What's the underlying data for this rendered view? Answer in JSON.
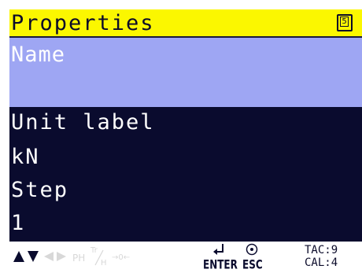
{
  "window": {
    "title": "Properties",
    "page_indicator": "5"
  },
  "fields": {
    "name_label": "Name",
    "name_value": "",
    "unit_label": "Unit label",
    "unit_value": "kN",
    "step_label": "Step",
    "step_value": "1"
  },
  "toolbar": {
    "ph_label": "PH",
    "tr_label_top": "Tr",
    "tr_label_bottom": "H",
    "zero_label": "→0←",
    "enter_label": "ENTER",
    "esc_label": "ESC",
    "tac_label": "TAC:9",
    "cal_label": "CAL:4"
  },
  "colors": {
    "title_bg": "#fbf700",
    "selected_bg": "#9ea6f3",
    "panel_bg": "#0a0b2e",
    "disabled_icon": "#d8d8d8"
  }
}
